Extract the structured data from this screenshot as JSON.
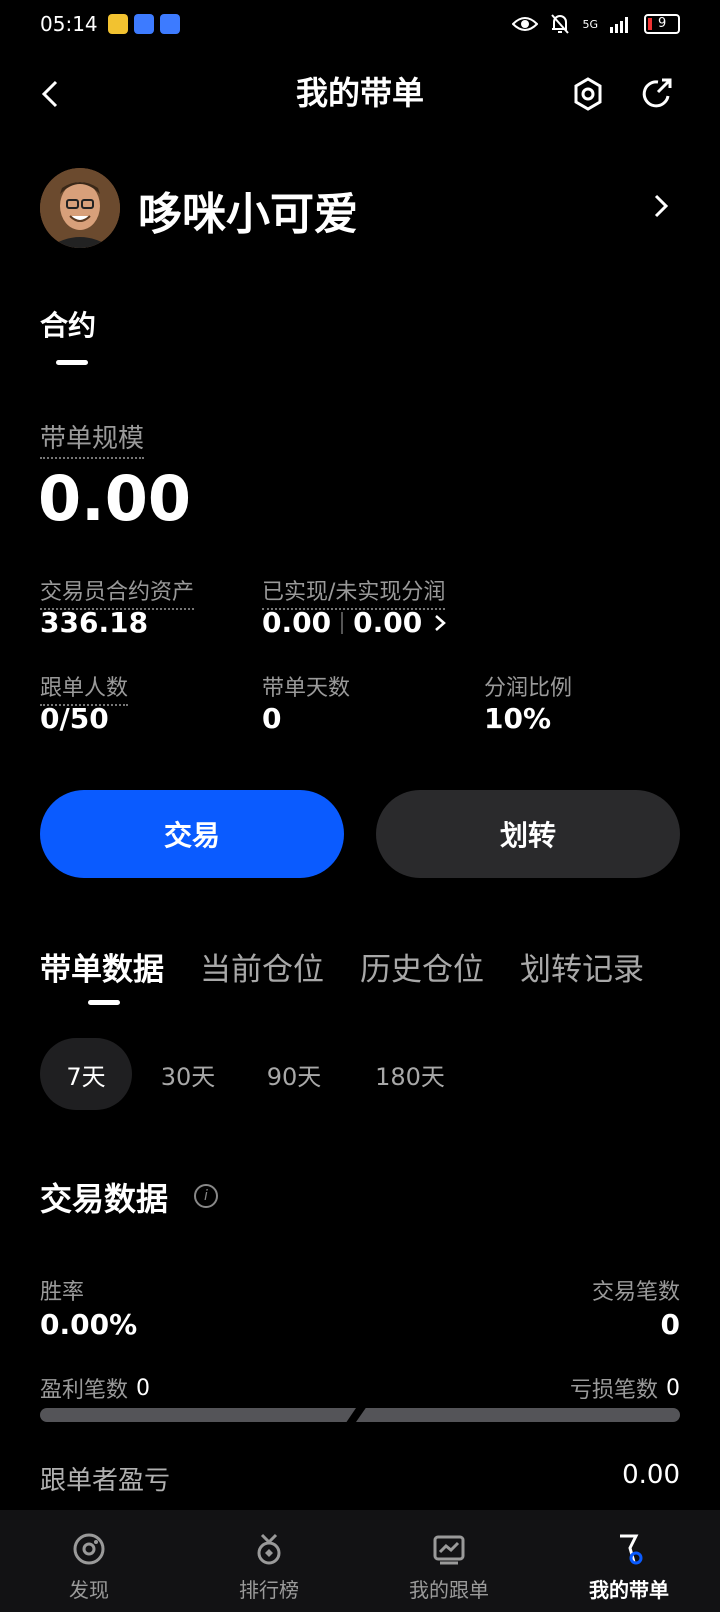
{
  "status_bar": {
    "time": "05:14",
    "network": "5G",
    "battery": "9"
  },
  "header": {
    "title": "我的带单"
  },
  "profile": {
    "nickname": "哆咪小可爱"
  },
  "top_tab": {
    "label": "合约"
  },
  "stats": {
    "scale_label": "带单规模",
    "scale_value": "0.00",
    "trader_assets_label": "交易员合约资产",
    "trader_assets_value": "336.18",
    "profit_share_label": "已实现/未实现分润",
    "realized_value": "0.00",
    "unrealized_value": "0.00",
    "followers_label": "跟单人数",
    "followers_value": "0/50",
    "days_label": "带单天数",
    "days_value": "0",
    "share_ratio_label": "分润比例",
    "share_ratio_value": "10%"
  },
  "actions": {
    "trade": "交易",
    "transfer": "划转"
  },
  "data_tabs": [
    "带单数据",
    "当前仓位",
    "历史仓位",
    "划转记录"
  ],
  "periods": [
    "7天",
    "30天",
    "90天",
    "180天"
  ],
  "trade_data": {
    "title": "交易数据",
    "win_rate_label": "胜率",
    "win_rate_value": "0.00%",
    "trade_count_label": "交易笔数",
    "trade_count_value": "0",
    "profit_count_label": "盈利笔数",
    "profit_count_value": "0",
    "loss_count_label": "亏损笔数",
    "loss_count_value": "0",
    "follower_pnl_label": "跟单者盈亏",
    "follower_pnl_value": "0.00"
  },
  "bottom_nav": {
    "discover": "发现",
    "ranking": "排行榜",
    "my_follow": "我的跟单",
    "my_lead": "我的带单"
  },
  "colors": {
    "accent": "#0a5bff",
    "background": "#000000",
    "secondary_button": "#2a2a2c"
  }
}
